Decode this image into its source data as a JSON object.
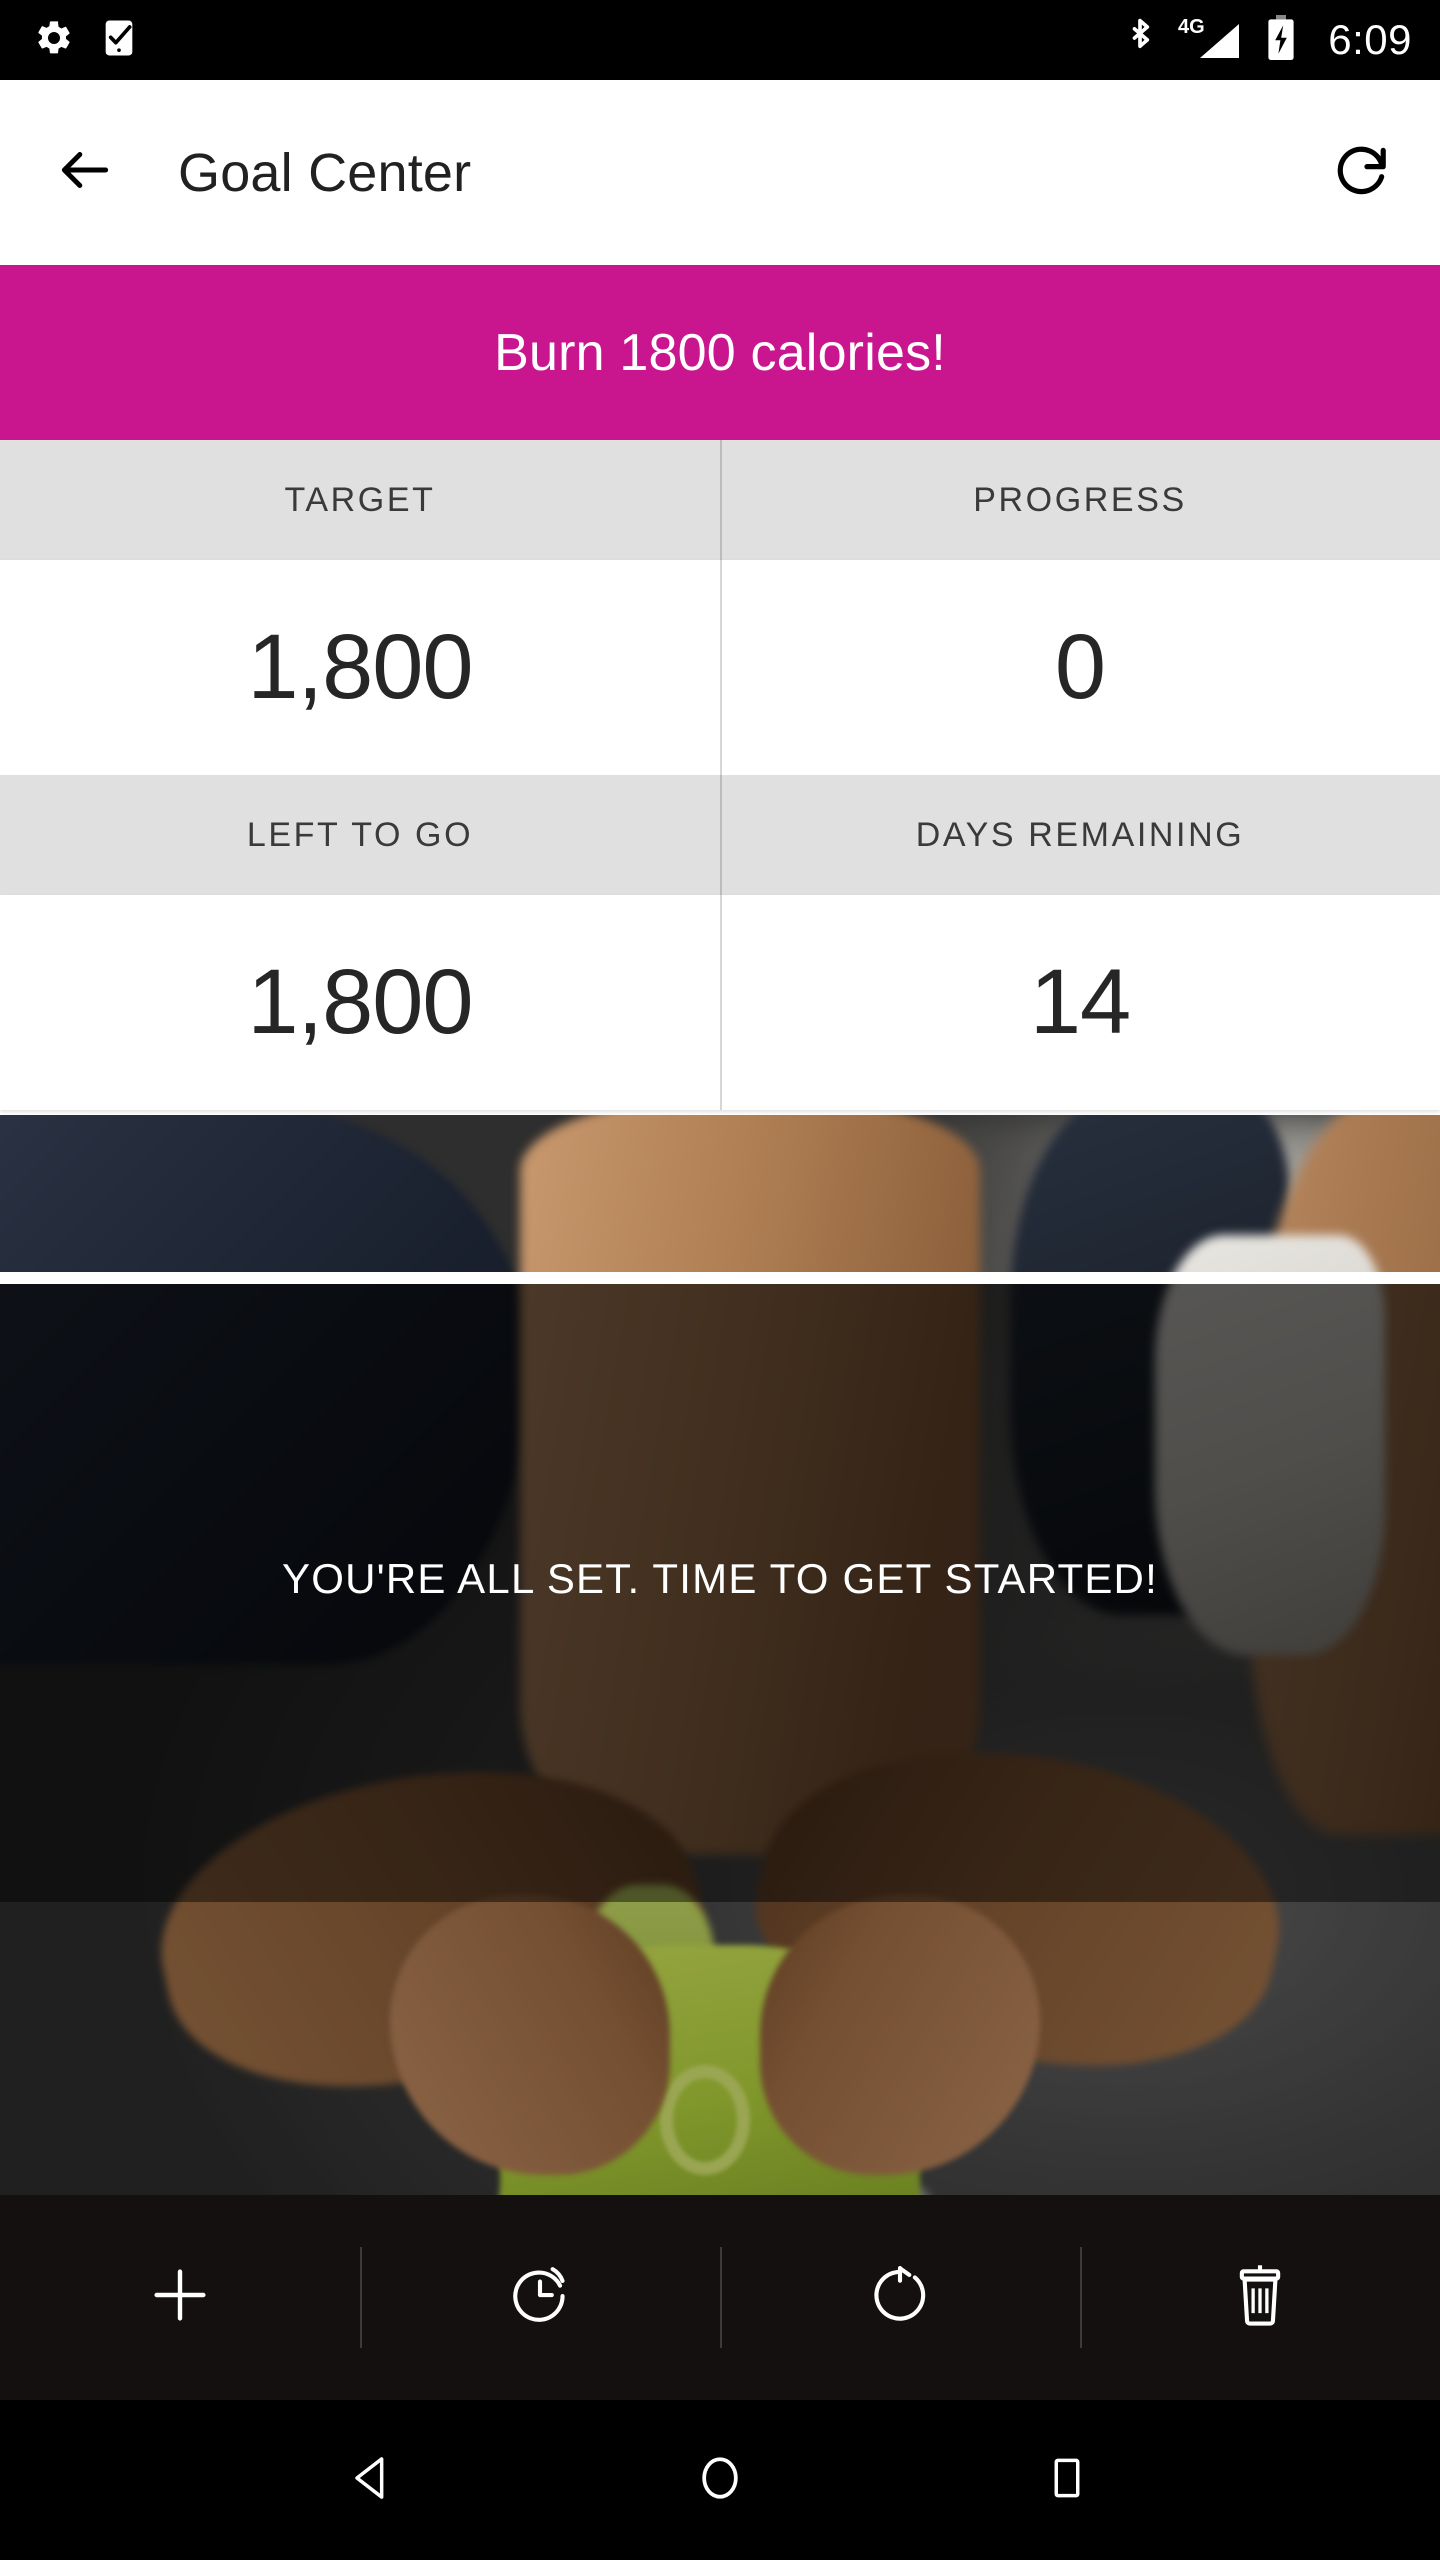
{
  "status_bar": {
    "time": "6:09",
    "icons_left": [
      "gear-icon",
      "phone-check-icon"
    ],
    "icons_right": [
      "bluetooth-icon",
      "signal-4g-icon",
      "battery-charging-icon"
    ],
    "network_label": "4G"
  },
  "app_bar": {
    "back_label": "back-arrow-icon",
    "title": "Goal Center",
    "refresh_label": "refresh-icon"
  },
  "banner": {
    "text": "Burn 1800 calories!",
    "color": "#C9168F"
  },
  "stats": {
    "rows": [
      {
        "cells": [
          {
            "label": "TARGET",
            "value": "1,800"
          },
          {
            "label": "PROGRESS",
            "value": "0"
          }
        ]
      },
      {
        "cells": [
          {
            "label": "LEFT TO GO",
            "value": "1,800"
          },
          {
            "label": "DAYS REMAINING",
            "value": "14"
          }
        ]
      }
    ],
    "label_bg": "#E0E0E0",
    "value_bg": "#FFFFFF"
  },
  "hero": {
    "overlay_text": "YOU'RE ALL SET. TIME TO GET STARTED!"
  },
  "toolbar": {
    "buttons": [
      {
        "name": "add-goal-button",
        "icon": "plus-icon"
      },
      {
        "name": "history-button",
        "icon": "clock-icon"
      },
      {
        "name": "restart-button",
        "icon": "rotate-icon"
      },
      {
        "name": "delete-button",
        "icon": "trash-icon"
      }
    ],
    "background": "#151010"
  },
  "nav_bar": {
    "buttons": [
      {
        "name": "nav-back",
        "icon": "triangle-back-icon"
      },
      {
        "name": "nav-home",
        "icon": "circle-home-icon"
      },
      {
        "name": "nav-recents",
        "icon": "square-recents-icon"
      }
    ]
  }
}
